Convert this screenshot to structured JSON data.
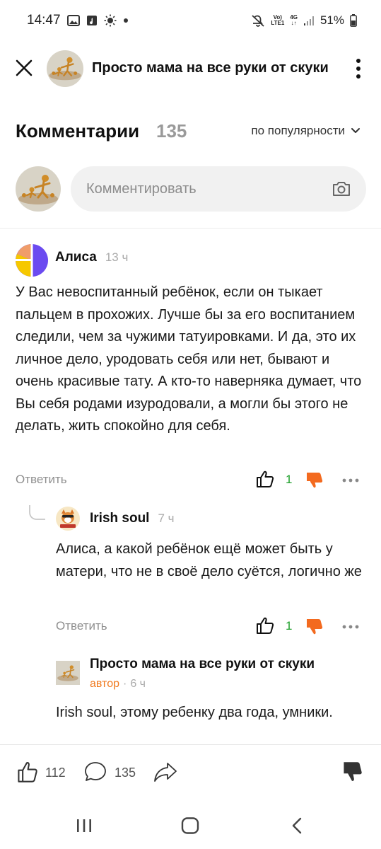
{
  "status_bar": {
    "time": "14:47",
    "net_top": "Vo)",
    "net_bottom": "LTE1",
    "gen": "4G",
    "battery": "51%"
  },
  "header": {
    "channel_title": "Просто мама на все руки от скуки"
  },
  "comments_section": {
    "title": "Комментарии",
    "count": "135",
    "sort_label": "по популярности"
  },
  "composer": {
    "placeholder": "Комментировать"
  },
  "comments": [
    {
      "author": "Алиса",
      "time": "13 ч",
      "text": "У Вас невоспитанный ребёнок, если он тыкает пальцем в прохожих. Лучше бы за его воспитанием следили, чем за чужими татуировками. И да, это их личное дело, уродовать себя или нет, бывают и очень красивые тату. А кто-то наверняка думает, что Вы себя родами изуродовали, а могли бы этого не делать, жить спокойно для себя.",
      "reply_label": "Ответить",
      "likes": "1"
    },
    {
      "author": "Irish soul",
      "time": "7 ч",
      "text": "Алиса, а какой ребёнок ещё может быть у матери, что не в своё дело суётся, логично же",
      "reply_label": "Ответить",
      "likes": "1"
    },
    {
      "author": "Просто мама на все руки от скуки",
      "author_badge": "автор",
      "separator": "·",
      "time": "6 ч",
      "text": "Irish soul, этому ребенку два года, умники."
    }
  ],
  "bottom_bar": {
    "likes": "112",
    "comments": "135"
  }
}
